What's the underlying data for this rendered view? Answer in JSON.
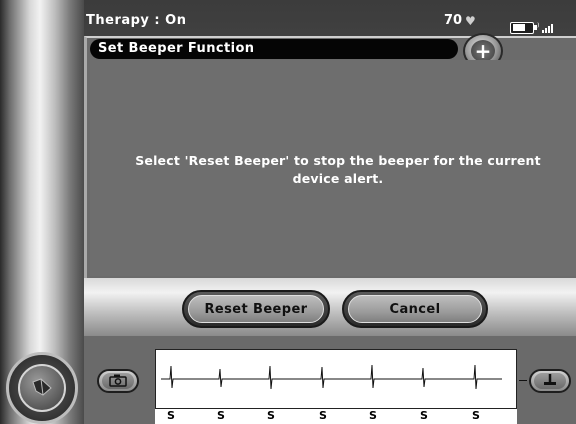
{
  "status": {
    "therapy_label": "Therapy : On",
    "heart_rate": "70",
    "icons": [
      "heart-icon",
      "battery-charging-icon",
      "wifi-icon",
      "signal-bars-icon"
    ]
  },
  "dialog": {
    "title": "Set Beeper Function",
    "message": "Select 'Reset Beeper' to stop the beeper for the current device alert.",
    "buttons": {
      "reset": "Reset Beeper",
      "cancel": "Cancel"
    },
    "add_icon": "plus-icon"
  },
  "ecg": {
    "beat_labels": [
      "S",
      "S",
      "S",
      "S",
      "S",
      "S",
      "S"
    ],
    "icons": [
      "camera-icon",
      "event-marker-icon",
      "navigation-dial-icon"
    ]
  },
  "colors": {
    "panel": "#6b6b6b",
    "title_bar": "#050505",
    "text": "#ffffff"
  }
}
